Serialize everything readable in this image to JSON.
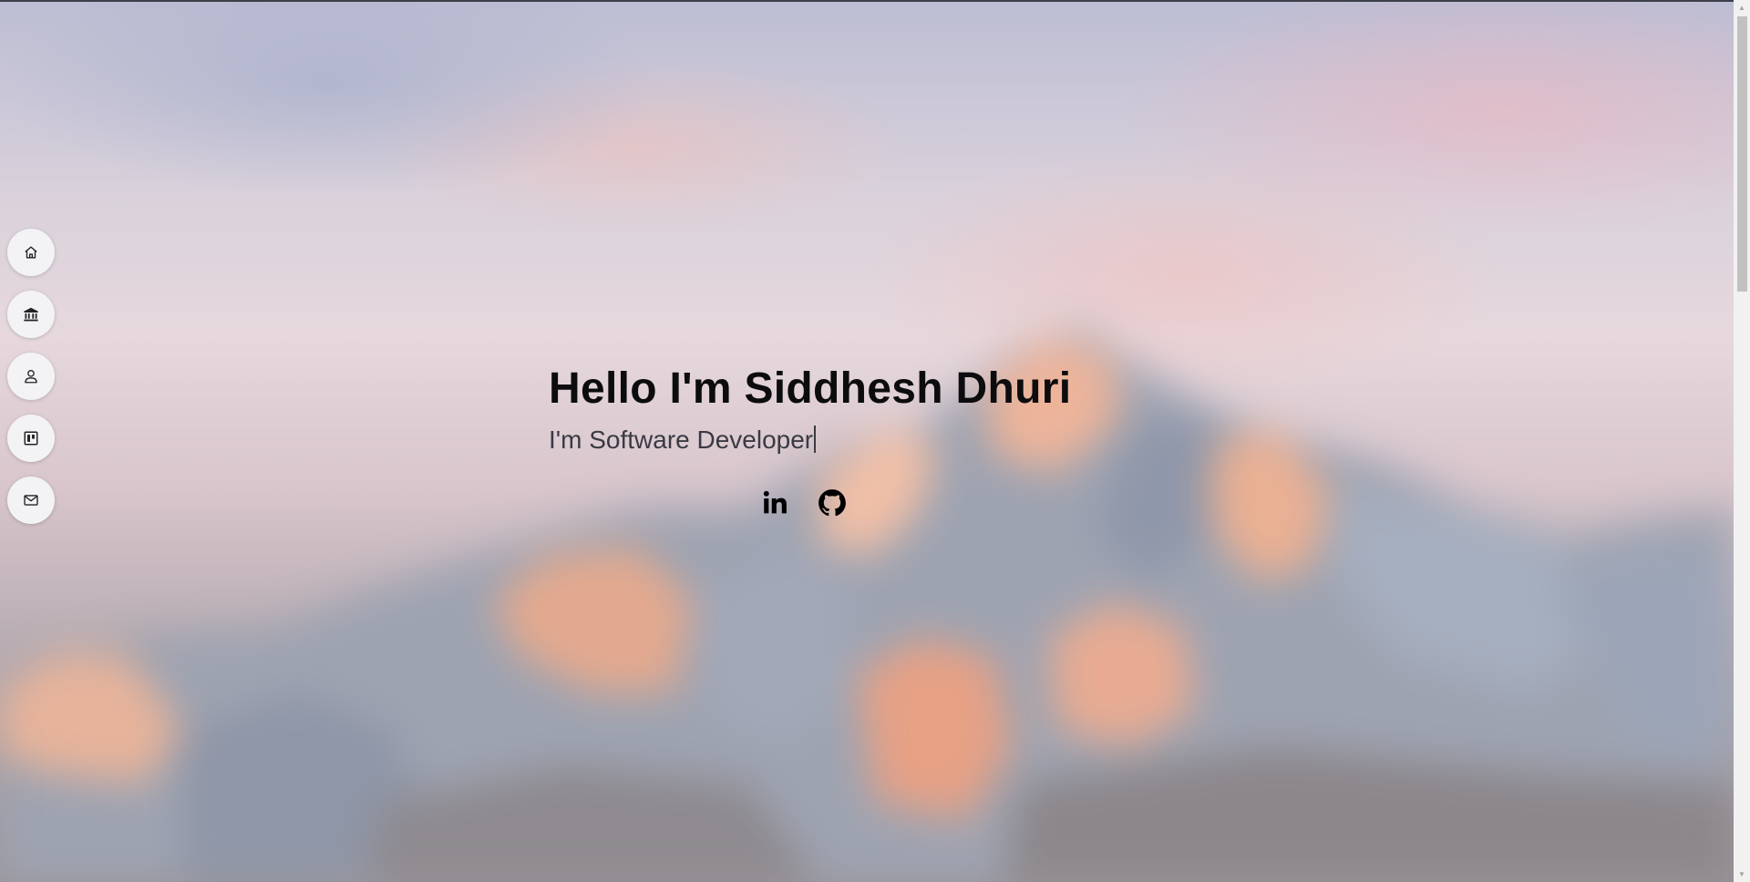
{
  "nav": {
    "items": [
      {
        "icon": "home-icon",
        "section": "home"
      },
      {
        "icon": "bank-icon",
        "section": "education"
      },
      {
        "icon": "person-icon",
        "section": "about"
      },
      {
        "icon": "board-icon",
        "section": "projects"
      },
      {
        "icon": "mail-icon",
        "section": "contact"
      }
    ]
  },
  "hero": {
    "title": "Hello I'm Siddhesh Dhuri",
    "subtitle": "I'm Software Developer"
  },
  "social": {
    "linkedin_icon": "linkedin-icon",
    "github_icon": "github-icon"
  },
  "colors": {
    "title": "#0c0c0e",
    "subtitle": "#3a3a44",
    "nav_button_bg": "#f3f3f6"
  }
}
